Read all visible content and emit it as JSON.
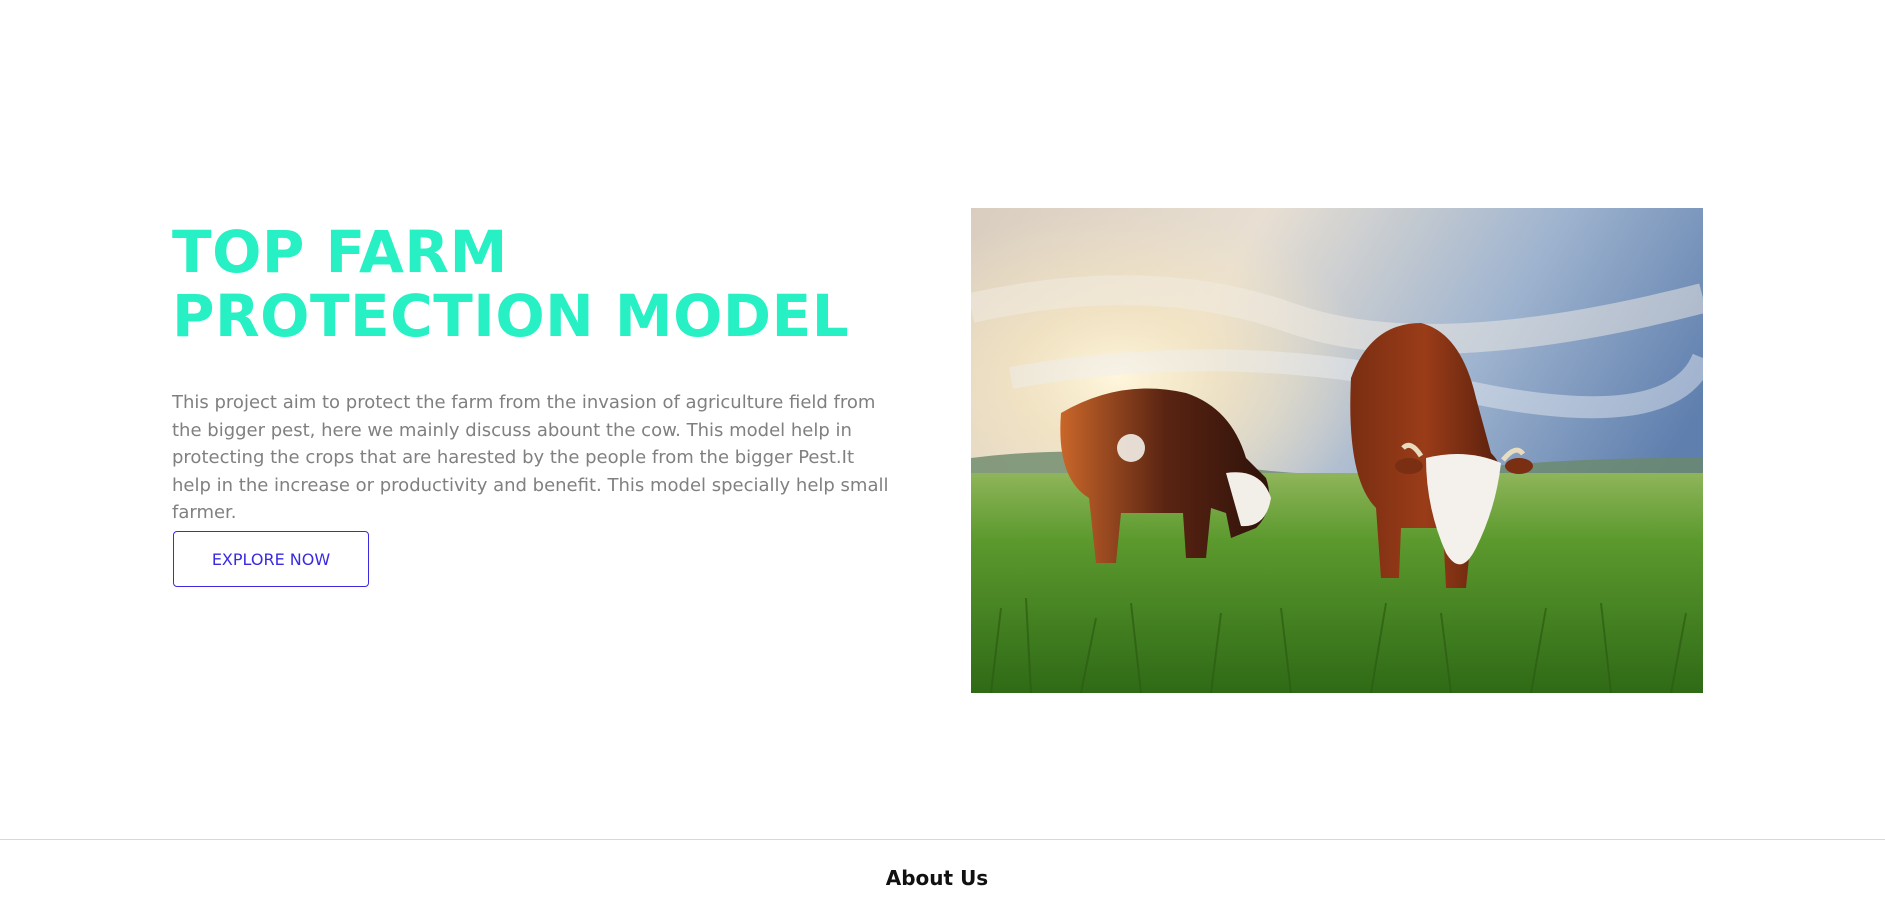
{
  "hero": {
    "title": "TOP FARM PROTECTION MODEL",
    "description": "This project aim to protect the farm from the invasion of agriculture field from the bigger pest, here we mainly discuss abount the cow. This model help in protecting the crops that are harested by the people from the bigger Pest.It help in the increase or productivity and benefit. This model specially help small farmer.",
    "button_label": "EXPLORE NOW",
    "title_color": "#26f0c4",
    "button_color": "#3a2ae0"
  },
  "image": {
    "subject": "two cows grazing in a green meadow at sunrise"
  },
  "footer": {
    "heading": "About Us"
  }
}
